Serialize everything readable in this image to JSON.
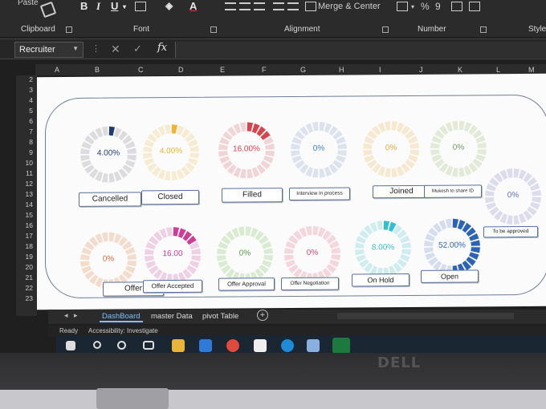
{
  "ribbon": {
    "paste_label": "Paste",
    "bold": "B",
    "italic": "I",
    "underline": "U",
    "font_color_letter": "A",
    "merge_center": "Merge & Center",
    "percent": "%",
    "comma": "9",
    "groups": {
      "clipboard": "Clipboard",
      "font": "Font",
      "alignment": "Alignment",
      "number": "Number",
      "styles": "Styles"
    }
  },
  "formula_bar": {
    "name_box": "Recruiter",
    "fx": "fx",
    "formula": ""
  },
  "columns": [
    "A",
    "B",
    "C",
    "D",
    "E",
    "F",
    "G",
    "H",
    "I",
    "J",
    "K",
    "L",
    "M"
  ],
  "rows": [
    "2",
    "3",
    "4",
    "5",
    "6",
    "7",
    "8",
    "9",
    "10",
    "11",
    "12",
    "13",
    "14",
    "15",
    "16",
    "17",
    "18",
    "19",
    "20",
    "21",
    "22",
    "23"
  ],
  "dashboard": {
    "charts": [
      {
        "label": "Cancelled",
        "value": "4.00%",
        "fraction": 0.04,
        "color": "#1f3b72",
        "bg": "#dcdcde"
      },
      {
        "label": "Closed",
        "value": "4.00%",
        "fraction": 0.04,
        "color": "#f2b233",
        "bg": "#f6ecd2"
      },
      {
        "label": "Filled",
        "value": "16.00%",
        "fraction": 0.16,
        "color": "#d8444e",
        "bg": "#f1d4d6"
      },
      {
        "label": "Interview in process",
        "value": "0%",
        "fraction": 0,
        "color": "#3d7fd6",
        "bg": "#dde3ee"
      },
      {
        "label": "Joined",
        "value": "0%",
        "fraction": 0,
        "color": "#f0a63c",
        "bg": "#f7e9d0"
      },
      {
        "label": "Mukesh to share ID",
        "value": "0%",
        "fraction": 0,
        "color": "#6e9a62",
        "bg": "#e3ead7"
      },
      {
        "label": "To be approved",
        "value": "0%",
        "fraction": 0,
        "color": "#5c6fd0",
        "bg": "#dcdcec"
      },
      {
        "label": "Offer",
        "value": "0%",
        "fraction": 0,
        "color": "#e06c3a",
        "bg": "#f4dccd"
      },
      {
        "label": "Offer Accepted",
        "value": "16.00",
        "fraction": 0.16,
        "color": "#cc3d96",
        "bg": "#efd0e4"
      },
      {
        "label": "Offer Approval",
        "value": "0%",
        "fraction": 0,
        "color": "#58a24a",
        "bg": "#d9ebd0"
      },
      {
        "label": "Offer Negotiation",
        "value": "0%",
        "fraction": 0,
        "color": "#dd4a7a",
        "bg": "#f5d6de"
      },
      {
        "label": "On Hold",
        "value": "8.00%",
        "fraction": 0.08,
        "color": "#34bfd0",
        "bg": "#cfecef"
      },
      {
        "label": "Open",
        "value": "52.00%",
        "fraction": 0.52,
        "color": "#2b63b8",
        "bg": "#d5ddee"
      }
    ]
  },
  "sheet_tabs": [
    "DashBoard",
    "master Data",
    "pivot Table"
  ],
  "active_tab": "DashBoard",
  "status": {
    "ready": "Ready",
    "accessibility": "Accessibility: Investigate"
  },
  "laptop_brand": "DELL"
}
